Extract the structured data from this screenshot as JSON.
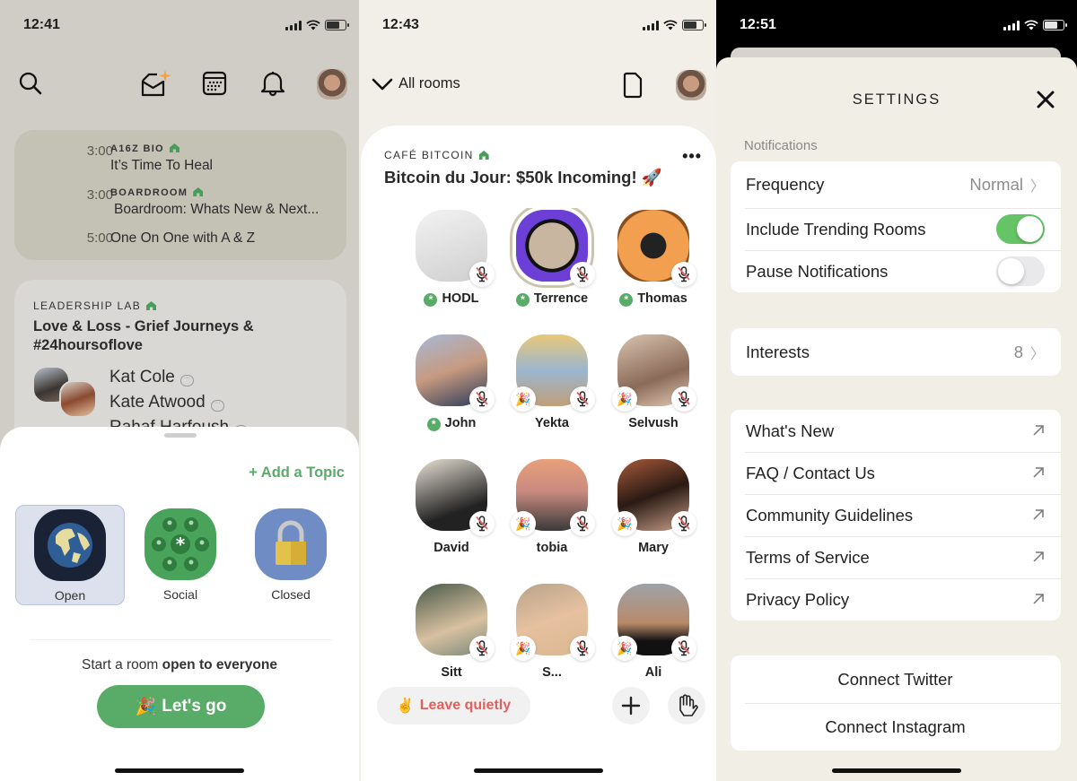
{
  "panel1": {
    "status": {
      "time": "12:41"
    },
    "upcoming": [
      {
        "time": "3:00",
        "club": "A16Z BIO",
        "title": "It’s Time To Heal"
      },
      {
        "time": "3:00",
        "club": "BOARDROOM",
        "title": "Boardroom: Whats New & Next..."
      },
      {
        "time": "5:00",
        "club": "",
        "title": "One On One with A & Z"
      }
    ],
    "room_card": {
      "club": "LEADERSHIP LAB",
      "title": "Love & Loss - Grief Journeys & #24hoursoflove",
      "speakers": [
        "Kat Cole",
        "Kate Atwood",
        "Rahaf Harfoush"
      ]
    },
    "sheet": {
      "add_topic": "+ Add a Topic",
      "room_types": [
        {
          "label": "Open",
          "selected": true
        },
        {
          "label": "Social",
          "selected": false
        },
        {
          "label": "Closed",
          "selected": false
        }
      ],
      "start_prefix": "Start a room ",
      "start_bold": "open to everyone",
      "go_emoji": "🎉",
      "go_label": "Let's go"
    }
  },
  "panel2": {
    "status": {
      "time": "12:43"
    },
    "all_rooms": "All rooms",
    "room": {
      "club": "CAFÉ BITCOIN",
      "title": "Bitcoin du Jour: $50k Incoming! 🚀",
      "more": "•••",
      "speakers": [
        {
          "name": "HODL",
          "moderator_star": true,
          "party": false
        },
        {
          "name": "Terrence",
          "moderator_star": true,
          "party": false,
          "speaking": true
        },
        {
          "name": "Thomas",
          "moderator_star": true,
          "party": false
        },
        {
          "name": "John",
          "moderator_star": true,
          "party": false
        },
        {
          "name": "Yekta",
          "moderator_star": false,
          "party": true
        },
        {
          "name": "Selvush",
          "moderator_star": false,
          "party": true
        },
        {
          "name": "David",
          "moderator_star": false,
          "party": false
        },
        {
          "name": "tobia",
          "moderator_star": false,
          "party": true
        },
        {
          "name": "Mary",
          "moderator_star": false,
          "party": true
        },
        {
          "name": "Sitt",
          "moderator_star": false,
          "party": false
        },
        {
          "name": "S...",
          "moderator_star": false,
          "party": true
        },
        {
          "name": "Ali",
          "moderator_star": false,
          "party": true
        }
      ]
    },
    "leave_emoji": "✌️",
    "leave_label": "Leave quietly"
  },
  "panel3": {
    "status": {
      "time": "12:51"
    },
    "title": "SETTINGS",
    "notifications_label": "Notifications",
    "notifications": {
      "frequency_label": "Frequency",
      "frequency_value": "Normal",
      "trending_label": "Include Trending Rooms",
      "trending_on": true,
      "pause_label": "Pause Notifications",
      "pause_on": false
    },
    "interests_label": "Interests",
    "interests_count": "8",
    "links": [
      "What's New",
      "FAQ / Contact Us",
      "Community Guidelines",
      "Terms of Service",
      "Privacy Policy"
    ],
    "connect": [
      "Connect Twitter",
      "Connect Instagram"
    ]
  },
  "colors": {
    "accent_green": "#58ac68",
    "leave_red": "#e0605e",
    "toggle_on": "#65c466"
  }
}
